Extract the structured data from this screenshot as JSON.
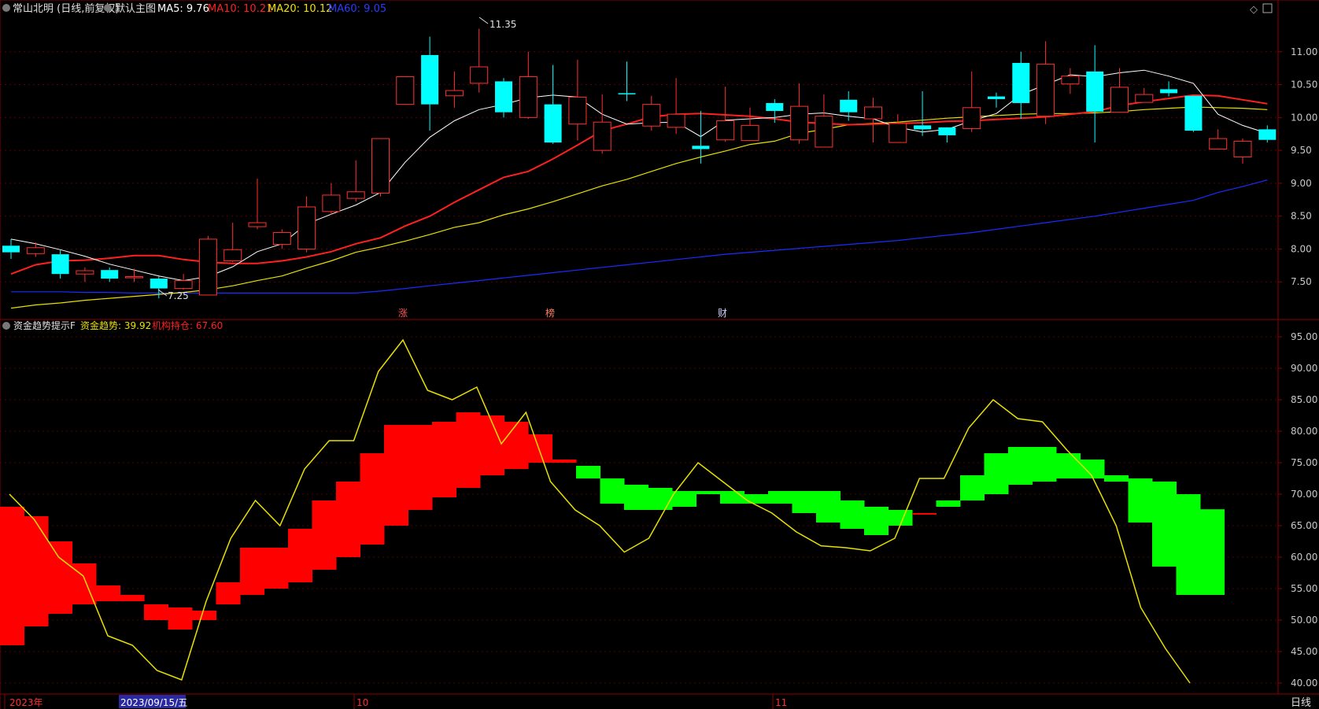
{
  "top_panel": {
    "title": "常山北明 (日线,前复权)",
    "chart_name": "默认主图",
    "legend": [
      {
        "label": "MA5: 9.76",
        "color": "#ffffff"
      },
      {
        "label": "MA10: 10.21",
        "color": "#ff2020"
      },
      {
        "label": "MA20: 10.12",
        "color": "#f0e000"
      },
      {
        "label": "MA60: 9.05",
        "color": "#2a3cff"
      }
    ],
    "annotations": {
      "high": "11.35",
      "low": "7.25"
    },
    "markers": [
      "涨",
      "榜",
      "财"
    ]
  },
  "bottom_panel": {
    "title": "资金趋势提示F",
    "legend": [
      {
        "label": "资金趋势: 39.92",
        "color": "#e8e000"
      },
      {
        "label": "机构持仓: 67.60",
        "color": "#ff2020"
      }
    ]
  },
  "x_axis": {
    "labels": [
      "2023年",
      "2023/09/15/五",
      "10",
      "11"
    ],
    "period_button": "日线"
  },
  "colors": {
    "up": "#ff3030",
    "down": "#00ffff",
    "bull": "#ff0000",
    "bear": "#00ff00",
    "trend": "#e8e000"
  },
  "chart_data": [
    {
      "type": "candlestick",
      "title": "常山北明 (日线,前复权)",
      "ylim": [
        7.0,
        11.5
      ],
      "yticks": [
        7.5,
        8.0,
        8.5,
        9.0,
        9.5,
        10.0,
        10.5,
        11.0
      ],
      "candles": [
        [
          8.05,
          7.95,
          8.15,
          7.85
        ],
        [
          7.93,
          8.02,
          8.1,
          7.88
        ],
        [
          7.92,
          7.62,
          7.98,
          7.55
        ],
        [
          7.62,
          7.67,
          7.72,
          7.5
        ],
        [
          7.68,
          7.55,
          7.72,
          7.5
        ],
        [
          7.58,
          7.58,
          7.7,
          7.5
        ],
        [
          7.55,
          7.4,
          7.58,
          7.25
        ],
        [
          7.4,
          7.52,
          7.62,
          7.38
        ],
        [
          7.3,
          8.15,
          8.2,
          7.3
        ],
        [
          7.82,
          7.99,
          8.4,
          7.8
        ],
        [
          8.34,
          8.4,
          9.07,
          8.3
        ],
        [
          8.07,
          8.25,
          8.3,
          8.0
        ],
        [
          8.0,
          8.64,
          8.8,
          7.95
        ],
        [
          8.57,
          8.82,
          9.0,
          8.52
        ],
        [
          8.77,
          8.87,
          9.35,
          8.72
        ],
        [
          8.85,
          9.68,
          9.68,
          8.8
        ],
        [
          10.2,
          10.62,
          10.62,
          10.2
        ],
        [
          10.95,
          10.2,
          11.23,
          9.8
        ],
        [
          10.33,
          10.41,
          10.7,
          10.15
        ],
        [
          10.52,
          10.77,
          11.35,
          10.38
        ],
        [
          10.55,
          10.08,
          10.6,
          10.0
        ],
        [
          10.0,
          10.62,
          11.0,
          9.98
        ],
        [
          10.2,
          9.62,
          10.8,
          9.6
        ],
        [
          9.9,
          10.31,
          10.88,
          9.65
        ],
        [
          9.5,
          9.93,
          10.35,
          9.45
        ],
        [
          10.37,
          10.36,
          10.85,
          10.25
        ],
        [
          9.87,
          10.2,
          10.33,
          9.8
        ],
        [
          9.85,
          10.05,
          10.6,
          9.75
        ],
        [
          9.57,
          9.52,
          10.1,
          9.3
        ],
        [
          9.66,
          9.95,
          10.47,
          9.63
        ],
        [
          9.65,
          9.88,
          10.15,
          9.8
        ],
        [
          10.22,
          10.1,
          10.28,
          9.92
        ],
        [
          9.66,
          10.17,
          10.52,
          9.6
        ],
        [
          9.55,
          10.02,
          10.35,
          9.55
        ],
        [
          10.27,
          10.08,
          10.4,
          9.95
        ],
        [
          9.98,
          10.16,
          10.3,
          9.62
        ],
        [
          9.62,
          9.91,
          10.05,
          9.9
        ],
        [
          9.88,
          9.82,
          10.4,
          9.72
        ],
        [
          9.85,
          9.73,
          9.85,
          9.62
        ],
        [
          9.83,
          10.15,
          10.7,
          9.78
        ],
        [
          10.32,
          10.28,
          10.38,
          10.15
        ],
        [
          10.83,
          10.22,
          11.0,
          9.98
        ],
        [
          10.02,
          10.81,
          11.16,
          9.9
        ],
        [
          10.51,
          10.63,
          10.75,
          10.36
        ],
        [
          10.7,
          10.09,
          11.1,
          9.62
        ],
        [
          10.08,
          10.46,
          10.75,
          10.3
        ],
        [
          10.23,
          10.35,
          10.45,
          10.28
        ],
        [
          10.43,
          10.37,
          10.55,
          10.32
        ],
        [
          10.33,
          9.8,
          10.3,
          9.78
        ],
        [
          9.52,
          9.68,
          9.82,
          9.52
        ],
        [
          9.4,
          9.64,
          9.68,
          9.3
        ],
        [
          9.82,
          9.66,
          9.88,
          9.62
        ]
      ],
      "ma": {
        "MA5": [
          8.15,
          8.08,
          7.99,
          7.89,
          7.77,
          7.68,
          7.59,
          7.52,
          7.58,
          7.73,
          7.96,
          8.08,
          8.38,
          8.53,
          8.67,
          8.86,
          9.32,
          9.7,
          9.95,
          10.12,
          10.2,
          10.3,
          10.34,
          10.31,
          10.05,
          9.9,
          9.92,
          9.93,
          9.71,
          9.96,
          9.98,
          10.0,
          10.05,
          10.07,
          10.02,
          9.98,
          9.85,
          9.78,
          9.82,
          9.95,
          10.06,
          10.35,
          10.5,
          10.65,
          10.62,
          10.68,
          10.72,
          10.63,
          10.52,
          10.05,
          9.88,
          9.76
        ],
        "MA10": [
          7.62,
          7.76,
          7.82,
          7.83,
          7.86,
          7.9,
          7.9,
          7.84,
          7.8,
          7.78,
          7.78,
          7.82,
          7.88,
          7.96,
          8.08,
          8.17,
          8.35,
          8.5,
          8.71,
          8.9,
          9.09,
          9.18,
          9.37,
          9.58,
          9.8,
          9.9,
          10.01,
          10.05,
          10.06,
          10.04,
          10.02,
          9.98,
          9.93,
          9.91,
          9.89,
          9.9,
          9.91,
          9.92,
          9.94,
          9.95,
          9.97,
          9.99,
          10.01,
          10.05,
          10.09,
          10.18,
          10.24,
          10.29,
          10.34,
          10.33,
          10.27,
          10.21
        ],
        "MA20": [
          7.1,
          7.15,
          7.18,
          7.22,
          7.25,
          7.28,
          7.31,
          7.34,
          7.38,
          7.44,
          7.52,
          7.59,
          7.71,
          7.82,
          7.95,
          8.03,
          8.12,
          8.22,
          8.33,
          8.4,
          8.52,
          8.61,
          8.72,
          8.84,
          8.96,
          9.06,
          9.18,
          9.3,
          9.4,
          9.49,
          9.59,
          9.64,
          9.76,
          9.82,
          9.89,
          9.91,
          9.93,
          9.96,
          9.99,
          10.01,
          10.03,
          10.05,
          10.06,
          10.06,
          10.07,
          10.09,
          10.12,
          10.14,
          10.16,
          10.15,
          10.14,
          10.12
        ],
        "MA60": [
          7.35,
          7.35,
          7.35,
          7.34,
          7.34,
          7.33,
          7.33,
          7.33,
          7.33,
          7.33,
          7.33,
          7.33,
          7.33,
          7.33,
          7.33,
          7.36,
          7.4,
          7.44,
          7.48,
          7.52,
          7.56,
          7.6,
          7.64,
          7.68,
          7.72,
          7.76,
          7.8,
          7.84,
          7.88,
          7.92,
          7.95,
          7.98,
          8.01,
          8.04,
          8.07,
          8.1,
          8.13,
          8.17,
          8.21,
          8.25,
          8.3,
          8.35,
          8.4,
          8.45,
          8.5,
          8.56,
          8.62,
          8.68,
          8.74,
          8.86,
          8.95,
          9.05
        ]
      }
    },
    {
      "type": "bar",
      "title": "资金趋势提示F",
      "ylim": [
        39,
        96
      ],
      "yticks": [
        40,
        45,
        50,
        55,
        60,
        65,
        70,
        75,
        80,
        85,
        90,
        95
      ],
      "series": [
        {
          "name": "资金趋势",
          "values": [
            70,
            66,
            60,
            57,
            47.5,
            46,
            42,
            40.5,
            53,
            63,
            69,
            65,
            74,
            78.5,
            78.5,
            89.5,
            94.5,
            86.5,
            85,
            87,
            78,
            83,
            72,
            67.5,
            65,
            60.8,
            63,
            70,
            75,
            72,
            69,
            67,
            64,
            61.8,
            61.5,
            61,
            63,
            72.5,
            72.5,
            80.5,
            85,
            82,
            81.5,
            77,
            73,
            65,
            52,
            45.5,
            40
          ]
        },
        {
          "name": "机构持仓",
          "bars": [
            [
              46,
              68
            ],
            [
              49,
              66.5
            ],
            [
              51,
              62.5
            ],
            [
              52.5,
              59
            ],
            [
              53,
              55.5
            ],
            [
              53,
              54
            ],
            [
              50,
              52.5
            ],
            [
              48.5,
              52
            ],
            [
              50,
              51.5
            ],
            [
              52.5,
              56
            ],
            [
              54,
              61.5
            ],
            [
              55,
              61.5
            ],
            [
              56,
              64.5
            ],
            [
              58,
              69
            ],
            [
              60,
              72
            ],
            [
              62,
              76.5
            ],
            [
              65,
              81
            ],
            [
              67.5,
              81
            ],
            [
              69.5,
              81.5
            ],
            [
              71,
              83
            ],
            [
              73,
              82.5
            ],
            [
              74,
              81.5
            ],
            [
              75,
              79.5
            ],
            [
              75,
              75.5
            ],
            [
              74.5,
              72.5
            ],
            [
              72.5,
              68.5
            ],
            [
              71.5,
              67.5
            ],
            [
              71,
              67.5
            ],
            [
              70.5,
              68
            ],
            [
              70.5,
              70
            ],
            [
              70.5,
              68.5
            ],
            [
              70,
              68.5
            ],
            [
              70.5,
              68.5
            ],
            [
              70.5,
              67
            ],
            [
              70.5,
              65.5
            ],
            [
              69,
              64.5
            ],
            [
              68,
              63.5
            ],
            [
              67.5,
              65
            ],
            [
              67,
              67
            ],
            [
              69,
              68
            ],
            [
              73,
              69
            ],
            [
              76.5,
              70
            ],
            [
              77.5,
              71.5
            ],
            [
              77.5,
              72
            ],
            [
              76.5,
              72.5
            ],
            [
              75.5,
              72.5
            ],
            [
              73,
              72
            ],
            [
              72.5,
              65.5
            ],
            [
              72,
              58.5
            ],
            [
              70,
              54
            ],
            [
              67.6,
              54
            ]
          ]
        }
      ]
    }
  ]
}
